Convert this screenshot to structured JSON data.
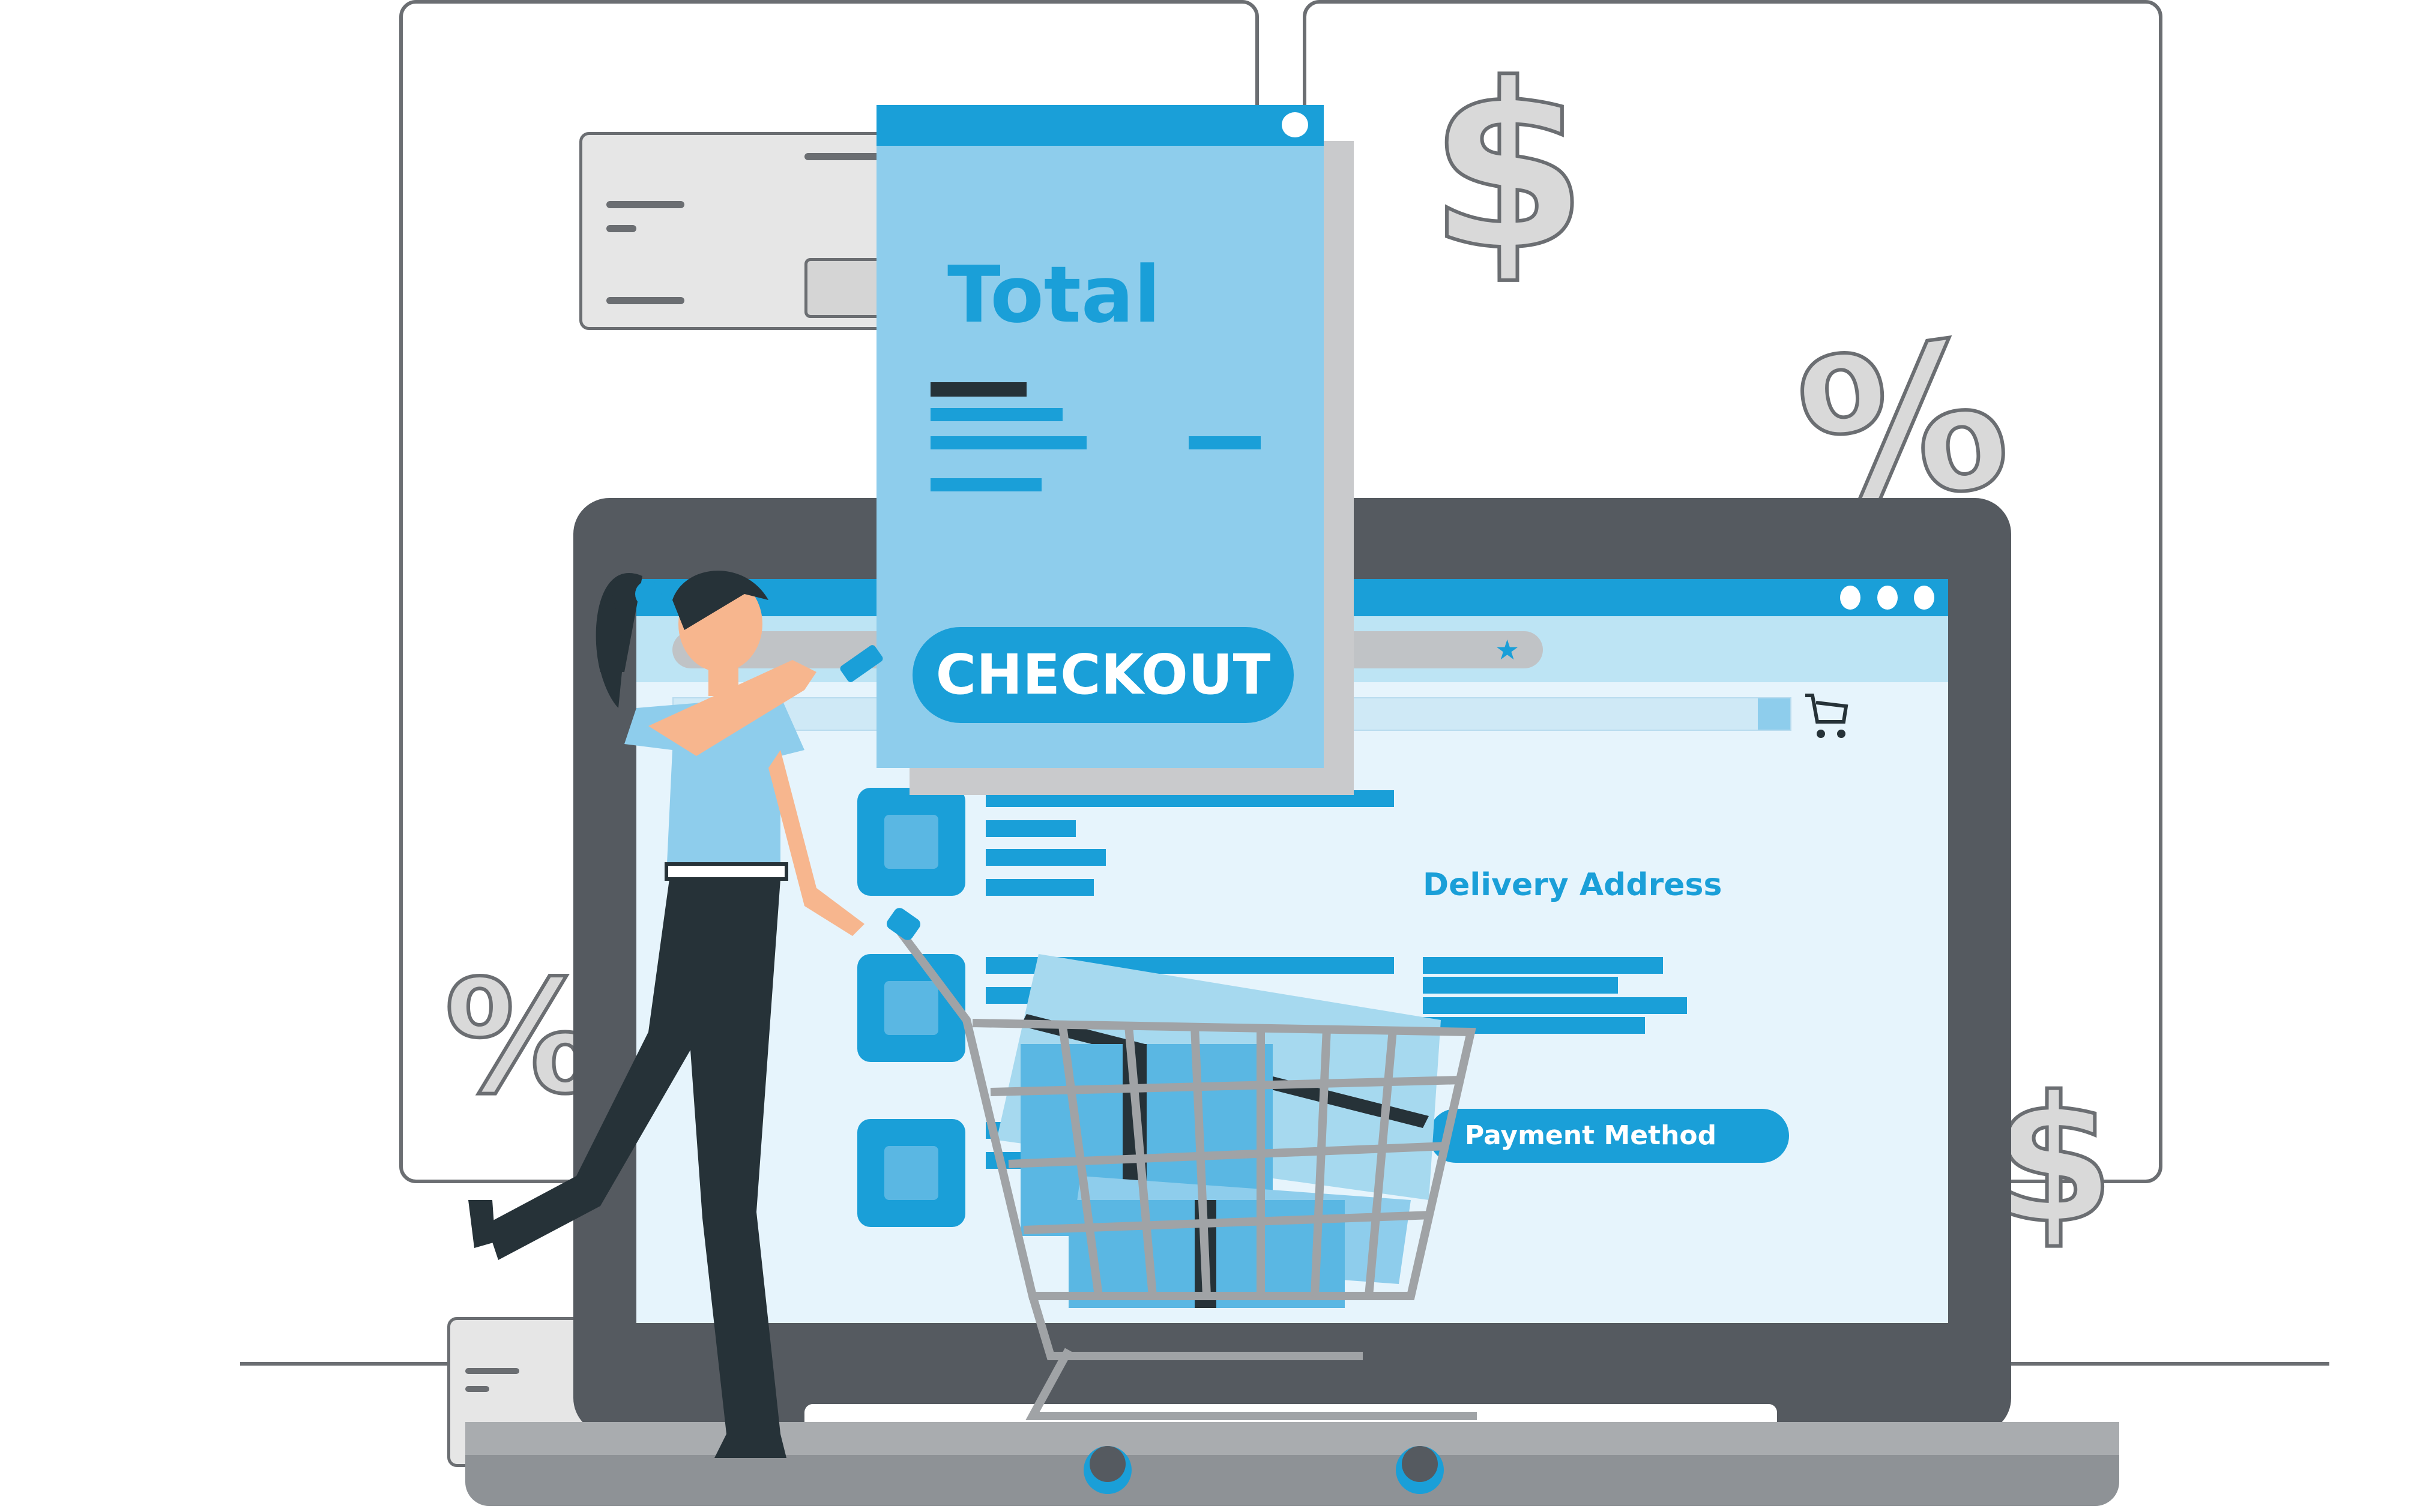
{
  "receipt": {
    "title": "Total",
    "checkout_label": "CHECKOUT"
  },
  "browser": {
    "window_dots": 3,
    "bookmark_icon": "star-icon",
    "cart_icon": "cart-icon"
  },
  "checkout_page": {
    "delivery_heading": "Delivery Address",
    "payment_label": "Payment Method"
  },
  "decor": {
    "dollar": "$",
    "percent": "%"
  },
  "colors": {
    "accent": "#1a9fd8",
    "light_blue": "#8ecdec",
    "screen_bg": "#e6f4fc",
    "laptop": "#555a60"
  }
}
